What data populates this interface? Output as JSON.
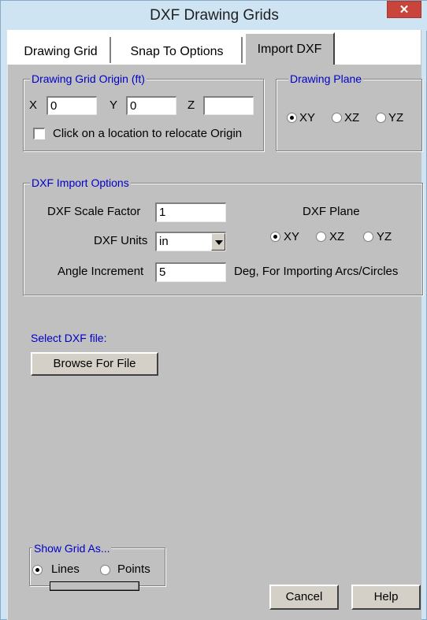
{
  "window": {
    "title": "DXF Drawing Grids",
    "close_glyph": "✕"
  },
  "tabs": [
    {
      "label": "Drawing Grid",
      "active": false
    },
    {
      "label": "Snap To Options",
      "active": false
    },
    {
      "label": "Import DXF",
      "active": true
    }
  ],
  "origin_group": {
    "legend": "Drawing Grid Origin (ft)",
    "x_label": "X",
    "x_value": "0",
    "y_label": "Y",
    "y_value": "0",
    "z_label": "Z",
    "z_value": "",
    "relocate_label": "Click on a location to relocate Origin",
    "relocate_checked": false
  },
  "plane_group": {
    "legend": "Drawing Plane",
    "options": [
      "XY",
      "XZ",
      "YZ"
    ],
    "selected": "XY"
  },
  "import_group": {
    "legend": "DXF Import Options",
    "scale_label": "DXF Scale Factor",
    "scale_value": "1",
    "units_label": "DXF Units",
    "units_value": "in",
    "angle_label": "Angle Increment",
    "angle_value": "5",
    "angle_note": "Deg, For Importing Arcs/Circles",
    "plane_label": "DXF Plane",
    "plane_options": [
      "XY",
      "XZ",
      "YZ"
    ],
    "plane_selected": "XY"
  },
  "file": {
    "label": "Select DXF file:",
    "browse_label": "Browse For File"
  },
  "show_grid": {
    "legend": "Show Grid As...",
    "options": [
      "Lines",
      "Points"
    ],
    "selected": "Lines",
    "progress": 0
  },
  "buttons": {
    "cancel": "Cancel",
    "help": "Help"
  }
}
